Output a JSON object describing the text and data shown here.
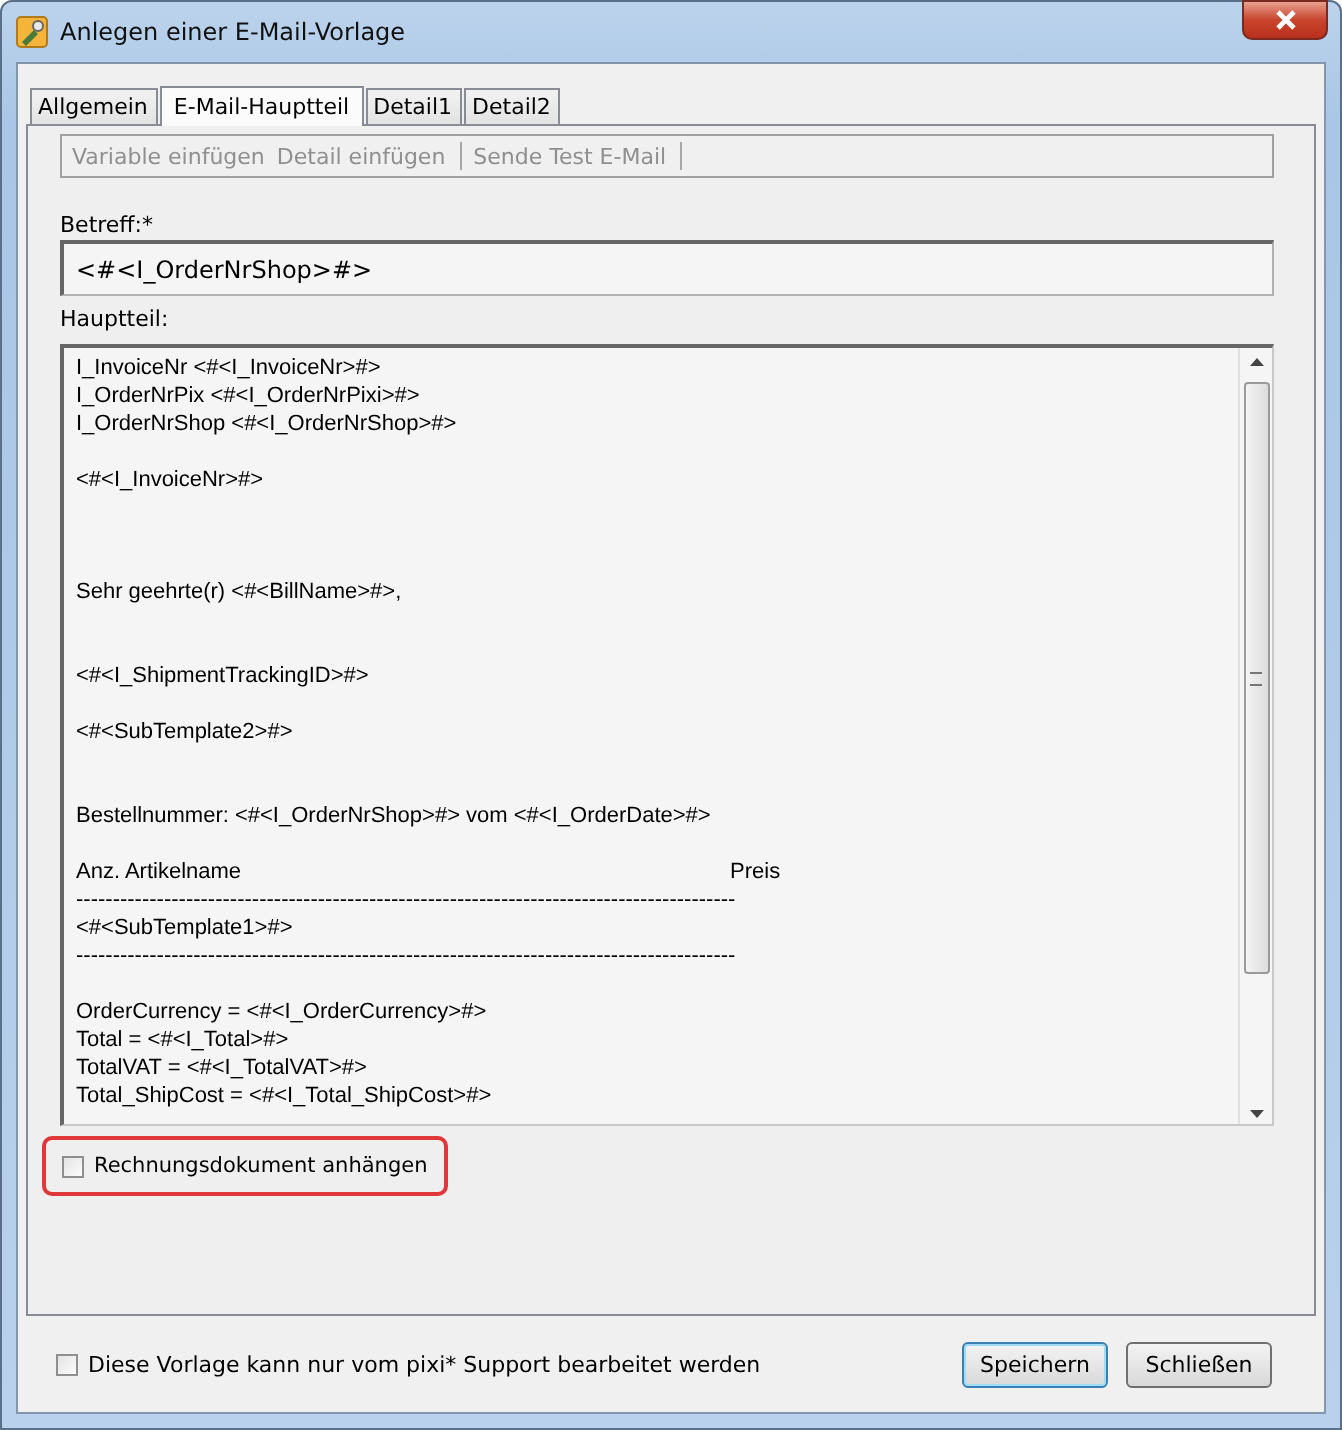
{
  "window": {
    "title": "Anlegen einer E-Mail-Vorlage"
  },
  "tabs": [
    {
      "label": "Allgemein",
      "selected": false
    },
    {
      "label": "E-Mail-Hauptteil",
      "selected": true
    },
    {
      "label": "Detail1",
      "selected": false
    },
    {
      "label": "Detail2",
      "selected": false
    }
  ],
  "toolbar": [
    {
      "label": "Variable einfügen",
      "disabled": true,
      "separator_after": false
    },
    {
      "label": "Detail einfügen",
      "disabled": true,
      "separator_after": true
    },
    {
      "label": "Sende Test E-Mail",
      "disabled": true,
      "separator_after": true
    }
  ],
  "subject": {
    "label": "Betreff:*",
    "value": "<#<I_OrderNrShop>#>"
  },
  "body": {
    "label": "Hauptteil:",
    "value": "I_InvoiceNr <#<I_InvoiceNr>#>\nI_OrderNrPix <#<I_OrderNrPixi>#>\nI_OrderNrShop <#<I_OrderNrShop>#>\n\n<#<I_InvoiceNr>#>\n\n\n\nSehr geehrte(r) <#<BillName>#>,\n\n\n<#<I_ShipmentTrackingID>#>\n\n<#<SubTemplate2>#>\n\n\nBestellnummer: <#<I_OrderNrShop>#> vom <#<I_OrderDate>#>\n\nAnz. Artikelname                                                                                Preis\n------------------------------------------------------------------------------------------\n<#<SubTemplate1>#>\n------------------------------------------------------------------------------------------\n\nOrderCurrency = <#<I_OrderCurrency>#>\nTotal = <#<I_Total>#>\nTotalVAT = <#<I_TotalVAT>#>\nTotal_ShipCost = <#<I_Total_ShipCost>#>"
  },
  "attach_invoice": {
    "label": "Rechnungsdokument anhängen",
    "checked": false,
    "highlighted": true
  },
  "support_only": {
    "label": "Diese Vorlage kann nur vom pixi* Support bearbeitet werden",
    "checked": false
  },
  "buttons": [
    {
      "label": "Speichern",
      "default": true
    },
    {
      "label": "Schließen",
      "default": false
    }
  ]
}
